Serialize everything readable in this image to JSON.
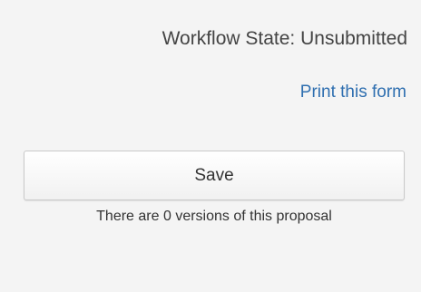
{
  "workflow": {
    "state_text": "Workflow State: Unsubmitted"
  },
  "actions": {
    "print_label": "Print this form",
    "save_label": "Save"
  },
  "versions": {
    "info_text": "There are 0 versions of this proposal"
  }
}
